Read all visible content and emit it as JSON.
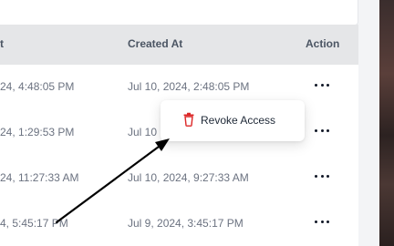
{
  "table": {
    "headers": {
      "last_used": "t",
      "created_at": "Created At",
      "action": "Action"
    },
    "rows": [
      {
        "last_used": "24, 4:48:05 PM",
        "created_at": "Jul 10, 2024, 2:48:05 PM"
      },
      {
        "last_used": "24, 1:29:53 PM",
        "created_at": "Jul 10"
      },
      {
        "last_used": "24, 11:27:33 AM",
        "created_at": "Jul 10, 2024, 9:27:33 AM"
      },
      {
        "last_used": "4, 5:45:17 PM",
        "created_at": "Jul 9, 2024, 3:45:17 PM"
      }
    ]
  },
  "popover": {
    "revoke_label": "Revoke Access",
    "icon": "trash-icon",
    "icon_color": "#dc2626"
  },
  "colors": {
    "header_bg": "#e5e6e8",
    "text_muted": "#6b7280",
    "arrow": "#000000"
  }
}
